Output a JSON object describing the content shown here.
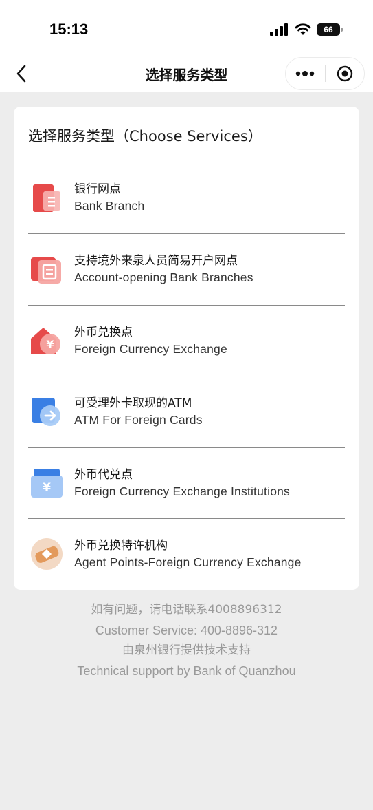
{
  "status_bar": {
    "time": "15:13",
    "battery": "66"
  },
  "nav": {
    "title": "选择服务类型"
  },
  "card": {
    "title": "选择服务类型（Choose Services）",
    "services": [
      {
        "cn": "银行网点",
        "en": "Bank Branch",
        "icon": "bank-branch-icon"
      },
      {
        "cn": "支持境外来泉人员简易开户网点",
        "en": "Account-opening Bank Branches",
        "icon": "account-opening-icon"
      },
      {
        "cn": "外币兑换点",
        "en": "Foreign Currency Exchange",
        "icon": "currency-exchange-icon"
      },
      {
        "cn": "可受理外卡取现的ATM",
        "en": "ATM For Foreign Cards",
        "icon": "atm-icon"
      },
      {
        "cn": "外币代兑点",
        "en": "Foreign Currency Exchange Institutions",
        "icon": "exchange-institution-icon"
      },
      {
        "cn": "外币兑换特许机构",
        "en": "Agent Points-Foreign Currency Exchange",
        "icon": "agent-points-icon"
      }
    ]
  },
  "footer": {
    "line1": "如有问题，请电话联系4008896312",
    "line2": "Customer Service: 400-8896-312",
    "line3": "由泉州银行提供技术支持",
    "line4": "Technical support by Bank of Quanzhou"
  },
  "colors": {
    "background": "#EDEDED",
    "card": "#FFFFFF",
    "icon_red": "#E94B4B",
    "icon_blue": "#3A86E8",
    "icon_orange": "#E8A36A",
    "footer_text": "#9A9A9A"
  }
}
